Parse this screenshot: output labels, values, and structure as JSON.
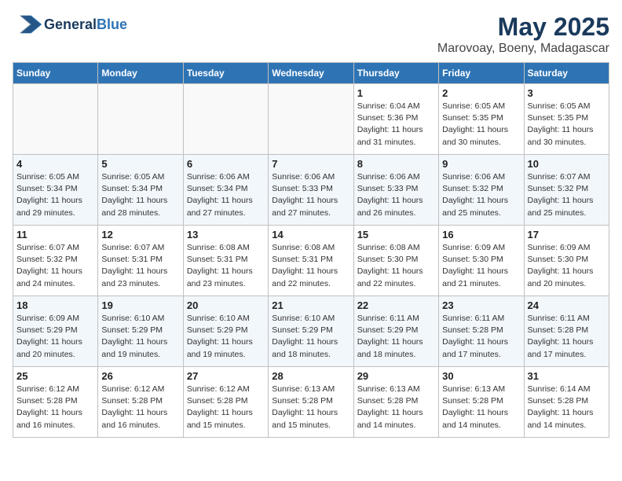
{
  "logo": {
    "general": "General",
    "blue": "Blue"
  },
  "title": "May 2025",
  "subtitle": "Marovoay, Boeny, Madagascar",
  "days_header": [
    "Sunday",
    "Monday",
    "Tuesday",
    "Wednesday",
    "Thursday",
    "Friday",
    "Saturday"
  ],
  "weeks": [
    [
      {
        "day": "",
        "detail": ""
      },
      {
        "day": "",
        "detail": ""
      },
      {
        "day": "",
        "detail": ""
      },
      {
        "day": "",
        "detail": ""
      },
      {
        "day": "1",
        "detail": "Sunrise: 6:04 AM\nSunset: 5:36 PM\nDaylight: 11 hours and 31 minutes."
      },
      {
        "day": "2",
        "detail": "Sunrise: 6:05 AM\nSunset: 5:35 PM\nDaylight: 11 hours and 30 minutes."
      },
      {
        "day": "3",
        "detail": "Sunrise: 6:05 AM\nSunset: 5:35 PM\nDaylight: 11 hours and 30 minutes."
      }
    ],
    [
      {
        "day": "4",
        "detail": "Sunrise: 6:05 AM\nSunset: 5:34 PM\nDaylight: 11 hours and 29 minutes."
      },
      {
        "day": "5",
        "detail": "Sunrise: 6:05 AM\nSunset: 5:34 PM\nDaylight: 11 hours and 28 minutes."
      },
      {
        "day": "6",
        "detail": "Sunrise: 6:06 AM\nSunset: 5:34 PM\nDaylight: 11 hours and 27 minutes."
      },
      {
        "day": "7",
        "detail": "Sunrise: 6:06 AM\nSunset: 5:33 PM\nDaylight: 11 hours and 27 minutes."
      },
      {
        "day": "8",
        "detail": "Sunrise: 6:06 AM\nSunset: 5:33 PM\nDaylight: 11 hours and 26 minutes."
      },
      {
        "day": "9",
        "detail": "Sunrise: 6:06 AM\nSunset: 5:32 PM\nDaylight: 11 hours and 25 minutes."
      },
      {
        "day": "10",
        "detail": "Sunrise: 6:07 AM\nSunset: 5:32 PM\nDaylight: 11 hours and 25 minutes."
      }
    ],
    [
      {
        "day": "11",
        "detail": "Sunrise: 6:07 AM\nSunset: 5:32 PM\nDaylight: 11 hours and 24 minutes."
      },
      {
        "day": "12",
        "detail": "Sunrise: 6:07 AM\nSunset: 5:31 PM\nDaylight: 11 hours and 23 minutes."
      },
      {
        "day": "13",
        "detail": "Sunrise: 6:08 AM\nSunset: 5:31 PM\nDaylight: 11 hours and 23 minutes."
      },
      {
        "day": "14",
        "detail": "Sunrise: 6:08 AM\nSunset: 5:31 PM\nDaylight: 11 hours and 22 minutes."
      },
      {
        "day": "15",
        "detail": "Sunrise: 6:08 AM\nSunset: 5:30 PM\nDaylight: 11 hours and 22 minutes."
      },
      {
        "day": "16",
        "detail": "Sunrise: 6:09 AM\nSunset: 5:30 PM\nDaylight: 11 hours and 21 minutes."
      },
      {
        "day": "17",
        "detail": "Sunrise: 6:09 AM\nSunset: 5:30 PM\nDaylight: 11 hours and 20 minutes."
      }
    ],
    [
      {
        "day": "18",
        "detail": "Sunrise: 6:09 AM\nSunset: 5:29 PM\nDaylight: 11 hours and 20 minutes."
      },
      {
        "day": "19",
        "detail": "Sunrise: 6:10 AM\nSunset: 5:29 PM\nDaylight: 11 hours and 19 minutes."
      },
      {
        "day": "20",
        "detail": "Sunrise: 6:10 AM\nSunset: 5:29 PM\nDaylight: 11 hours and 19 minutes."
      },
      {
        "day": "21",
        "detail": "Sunrise: 6:10 AM\nSunset: 5:29 PM\nDaylight: 11 hours and 18 minutes."
      },
      {
        "day": "22",
        "detail": "Sunrise: 6:11 AM\nSunset: 5:29 PM\nDaylight: 11 hours and 18 minutes."
      },
      {
        "day": "23",
        "detail": "Sunrise: 6:11 AM\nSunset: 5:28 PM\nDaylight: 11 hours and 17 minutes."
      },
      {
        "day": "24",
        "detail": "Sunrise: 6:11 AM\nSunset: 5:28 PM\nDaylight: 11 hours and 17 minutes."
      }
    ],
    [
      {
        "day": "25",
        "detail": "Sunrise: 6:12 AM\nSunset: 5:28 PM\nDaylight: 11 hours and 16 minutes."
      },
      {
        "day": "26",
        "detail": "Sunrise: 6:12 AM\nSunset: 5:28 PM\nDaylight: 11 hours and 16 minutes."
      },
      {
        "day": "27",
        "detail": "Sunrise: 6:12 AM\nSunset: 5:28 PM\nDaylight: 11 hours and 15 minutes."
      },
      {
        "day": "28",
        "detail": "Sunrise: 6:13 AM\nSunset: 5:28 PM\nDaylight: 11 hours and 15 minutes."
      },
      {
        "day": "29",
        "detail": "Sunrise: 6:13 AM\nSunset: 5:28 PM\nDaylight: 11 hours and 14 minutes."
      },
      {
        "day": "30",
        "detail": "Sunrise: 6:13 AM\nSunset: 5:28 PM\nDaylight: 11 hours and 14 minutes."
      },
      {
        "day": "31",
        "detail": "Sunrise: 6:14 AM\nSunset: 5:28 PM\nDaylight: 11 hours and 14 minutes."
      }
    ]
  ]
}
